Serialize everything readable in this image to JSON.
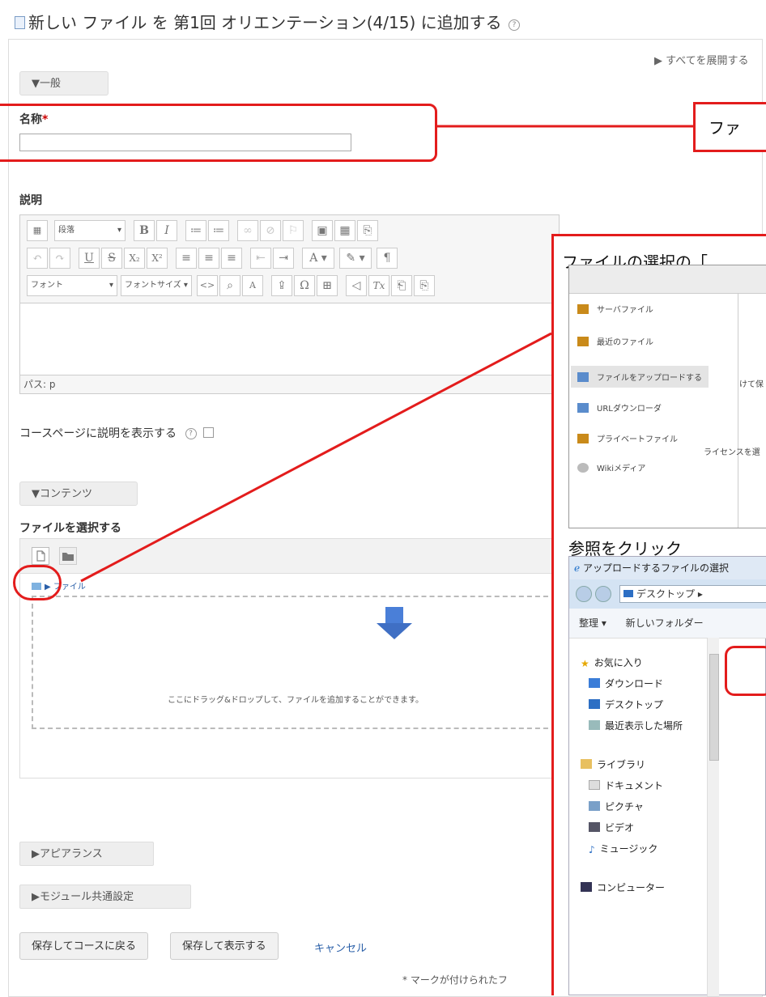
{
  "page": {
    "title": "新しい ファイル を 第1回 オリエンテーション(4/15) に追加する",
    "help_symbol": "?",
    "expand_all": "▶ すべてを展開する"
  },
  "general": {
    "section_label": "▼一般",
    "name_label": "名称",
    "required_mark": "*",
    "name_value": "",
    "description_label": "説明"
  },
  "editor": {
    "paragraph_select": "段落",
    "font_select": "フォント",
    "fontsize_select": "フォントサイズ",
    "buttons_row1": [
      "B",
      "I",
      "≔",
      "≔",
      "∞",
      "⊘",
      "⚐",
      "▣",
      "▦",
      "⎘"
    ],
    "buttons_row2": [
      "↶",
      "↷",
      "U",
      "S",
      "X₂",
      "X²",
      "≡",
      "≡",
      "≡",
      "⇤",
      "⇥",
      "A",
      "✎",
      "¶"
    ],
    "buttons_row3": [
      "<>",
      "⌕",
      "A",
      "⇪",
      "Ω",
      "⊞",
      "◁",
      "Tx",
      "⎗",
      "⎘"
    ],
    "path_label": "パス: p",
    "show_description_label": "コースページに説明を表示する"
  },
  "content": {
    "section_label": "▼コンテンツ",
    "select_files_label": "ファイルを選択する",
    "folder_label": "▶ ファイル",
    "drop_hint": "ここにドラッグ&ドロップして、ファイルを追加することができます。"
  },
  "sections": {
    "appearance": "▶アピアランス",
    "module_settings": "▶モジュール共通設定"
  },
  "buttons": {
    "save_return": "保存してコースに戻る",
    "save_display": "保存して表示する",
    "cancel": "キャンセル"
  },
  "footer_note": "* マークが付けられたフ",
  "callouts": {
    "file_callout": "ファ",
    "select_callout": "ファイルの選択の「",
    "browse_callout": "参照をクリック"
  },
  "picker": {
    "items": [
      "サーバファイル",
      "最近のファイル",
      "ファイルをアップロードする",
      "URLダウンローダ",
      "プライベートファイル",
      "Wikiメディア"
    ],
    "side_text_1": "けて保",
    "side_text_2": "ライセンスを選"
  },
  "explorer": {
    "title": "アップロードするファイルの選択",
    "location": "デスクトップ ▸",
    "organize": "整理 ▾",
    "new_folder": "新しいフォルダー",
    "tree": [
      "お気に入り",
      "ダウンロード",
      "デスクトップ",
      "最近表示した場所",
      "ライブラリ",
      "ドキュメント",
      "ピクチャ",
      "ビデオ",
      "ミュージック",
      "コンピューター"
    ]
  },
  "colors": {
    "annotation_red": "#e31c1c",
    "link_blue": "#2a5fa8",
    "required_red": "#cc0000"
  }
}
